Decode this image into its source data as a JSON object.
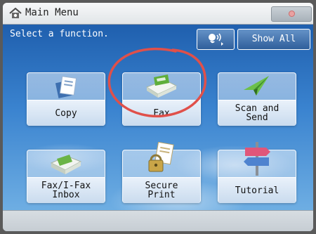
{
  "header": {
    "title": "Main Menu"
  },
  "main": {
    "prompt": "Select a function.",
    "show_all_label": "Show All",
    "tiles": [
      {
        "label": "Copy",
        "icon": "copy-icon"
      },
      {
        "label": "Fax",
        "icon": "fax-icon"
      },
      {
        "label": "Scan and\nSend",
        "icon": "scan-and-send-icon"
      },
      {
        "label": "Fax/I-Fax\nInbox",
        "icon": "fax-inbox-icon"
      },
      {
        "label": "Secure\nPrint",
        "icon": "secure-print-icon"
      },
      {
        "label": "Tutorial",
        "icon": "tutorial-icon"
      }
    ]
  },
  "colors": {
    "background_blue": "#2f73c0",
    "highlight_ring": "#e0504a"
  }
}
